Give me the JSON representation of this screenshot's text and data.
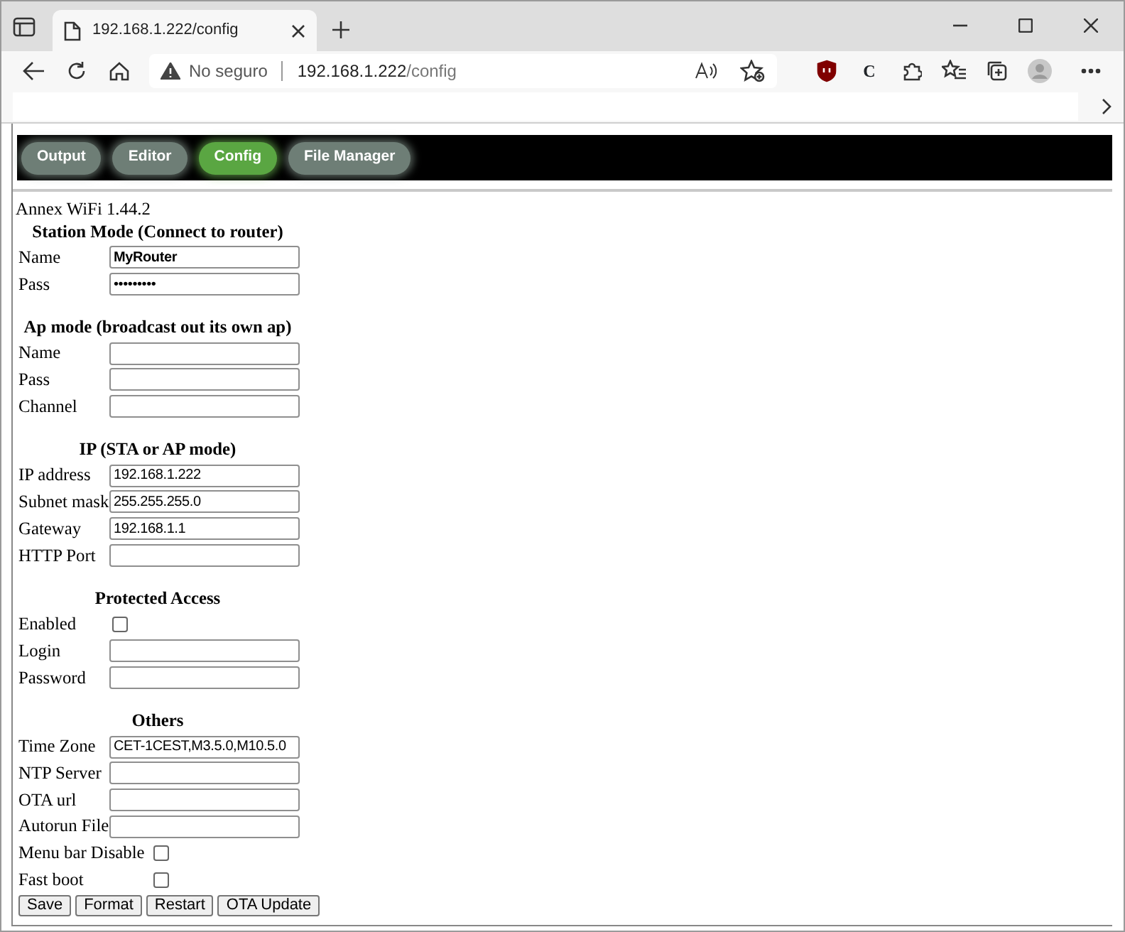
{
  "browser": {
    "tab_title": "192.168.1.222/config",
    "security": "No seguro",
    "url_host": "192.168.1.222",
    "url_path": "/config",
    "extension_label": "C"
  },
  "nav": [
    {
      "label": "Output",
      "selected": false
    },
    {
      "label": "Editor",
      "selected": false
    },
    {
      "label": "Config",
      "selected": true
    },
    {
      "label": "File Manager",
      "selected": false
    }
  ],
  "version": "Annex WiFi 1.44.2",
  "sections": [
    {
      "title": "Station Mode (Connect to router)",
      "rows": [
        {
          "kind": "text",
          "label": "Name",
          "value": "MyRouter",
          "bold": true
        },
        {
          "kind": "text",
          "label": "Pass",
          "value": "•••••••••"
        }
      ]
    },
    {
      "title": "Ap mode (broadcast out its own ap)",
      "rows": [
        {
          "kind": "text",
          "label": "Name"
        },
        {
          "kind": "text",
          "label": "Pass"
        },
        {
          "kind": "text",
          "label": "Channel"
        }
      ]
    },
    {
      "title": "IP (STA or AP mode)",
      "rows": [
        {
          "kind": "text",
          "label": "IP address",
          "value": "192.168.1.222"
        },
        {
          "kind": "text",
          "label": "Subnet mask",
          "value": "255.255.255.0"
        },
        {
          "kind": "text",
          "label": "Gateway",
          "value": "192.168.1.1"
        },
        {
          "kind": "text",
          "label": "HTTP Port"
        }
      ]
    },
    {
      "title": "Protected Access",
      "rows": [
        {
          "kind": "checkbox",
          "label": "Enabled",
          "checked": false
        },
        {
          "kind": "text",
          "label": "Login"
        },
        {
          "kind": "text",
          "label": "Password"
        }
      ]
    },
    {
      "title": "Others",
      "rows": [
        {
          "kind": "text",
          "label": "Time Zone",
          "value": "CET-1CEST,M3.5.0,M10.5.0"
        },
        {
          "kind": "text",
          "label": "NTP Server"
        },
        {
          "kind": "text",
          "label": "OTA url"
        },
        {
          "kind": "text",
          "label": "Autorun File"
        },
        {
          "kind": "checkbox",
          "label": "Menu bar Disable",
          "checked": false
        },
        {
          "kind": "checkbox",
          "label": "Fast boot",
          "checked": false
        }
      ]
    }
  ],
  "buttons": [
    "Save",
    "Format",
    "Restart",
    "OTA Update"
  ]
}
